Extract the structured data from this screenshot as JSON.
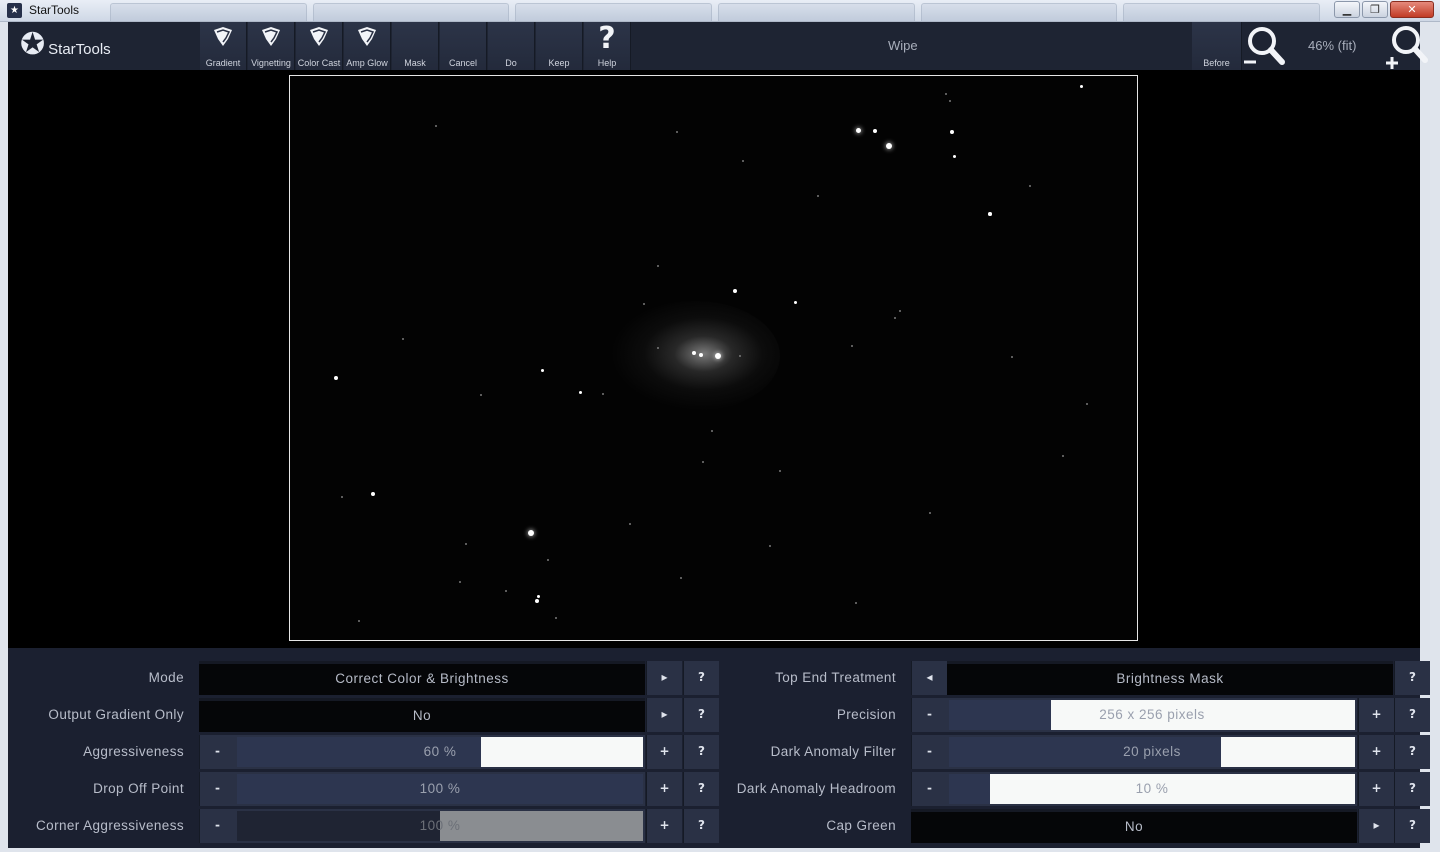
{
  "window": {
    "title": "StarTools",
    "controls": [
      "minimize",
      "maximize",
      "close"
    ]
  },
  "toolbar": {
    "logo_text": "StarTools",
    "buttons": [
      {
        "label": "Gradient",
        "icon": "wipe-icon"
      },
      {
        "label": "Vignetting",
        "icon": "wipe-icon"
      },
      {
        "label": "Color Cast",
        "icon": "wipe-icon"
      },
      {
        "label": "Amp Glow",
        "icon": "wipe-icon"
      },
      {
        "label": "Mask",
        "icon": "blank"
      },
      {
        "label": "Cancel",
        "icon": "blank"
      },
      {
        "label": "Do",
        "icon": "blank"
      },
      {
        "label": "Keep",
        "icon": "blank"
      },
      {
        "label": "Help",
        "icon": "question-icon",
        "glyph": "?"
      }
    ],
    "tool_title": "Wipe",
    "before_label": "Before",
    "zoom_level": "46% (fit)"
  },
  "params_left": [
    {
      "label": "Mode",
      "type": "choice",
      "value": "Correct Color & Brightness"
    },
    {
      "label": "Output Gradient Only",
      "type": "choice",
      "value": "No"
    },
    {
      "label": "Aggressiveness",
      "type": "slider",
      "value": "60 %",
      "fraction": 0.6
    },
    {
      "label": "Drop Off Point",
      "type": "slider",
      "value": "100 %",
      "fraction": 1.0
    },
    {
      "label": "Corner Aggressiveness",
      "type": "slider",
      "value": "100 %",
      "fraction": 0.5,
      "disabled": true
    }
  ],
  "params_right": [
    {
      "label": "Top End Treatment",
      "type": "choice",
      "value": "Brightness Mask"
    },
    {
      "label": "Precision",
      "type": "slider",
      "value": "256 x 256 pixels",
      "fraction": 0.25
    },
    {
      "label": "Dark Anomaly Filter",
      "type": "slider",
      "value": "20 pixels",
      "fraction": 0.67
    },
    {
      "label": "Dark Anomaly Headroom",
      "type": "slider",
      "value": "10 %",
      "fraction": 0.1
    },
    {
      "label": "Cap Green",
      "type": "choice",
      "value": "No"
    }
  ],
  "symbols": {
    "minus": "-",
    "plus": "+",
    "help": "?",
    "next": "▸",
    "prev": "◂"
  }
}
